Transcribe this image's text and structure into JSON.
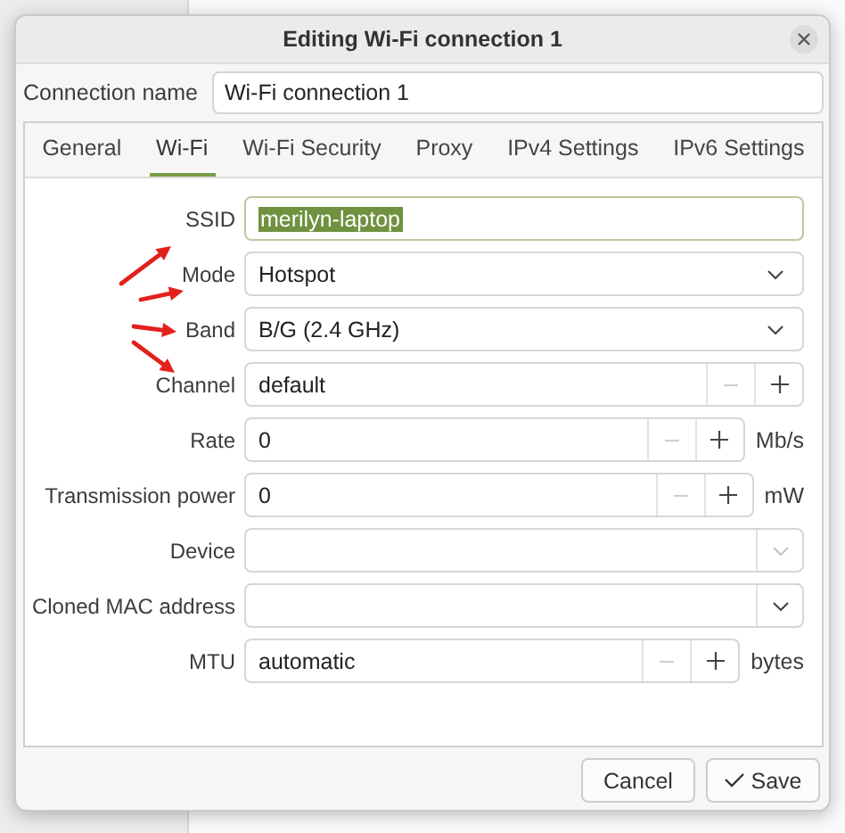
{
  "window": {
    "title": "Editing Wi-Fi connection 1"
  },
  "connection_name": {
    "label": "Connection name",
    "value": "Wi-Fi connection 1"
  },
  "tabs": [
    {
      "label": "General",
      "selected": false
    },
    {
      "label": "Wi-Fi",
      "selected": true
    },
    {
      "label": "Wi-Fi Security",
      "selected": false
    },
    {
      "label": "Proxy",
      "selected": false
    },
    {
      "label": "IPv4 Settings",
      "selected": false
    },
    {
      "label": "IPv6 Settings",
      "selected": false
    }
  ],
  "fields": [
    {
      "kind": "text",
      "label": "SSID",
      "value": "merilyn-laptop",
      "highlighted": true
    },
    {
      "kind": "dropdown",
      "label": "Mode",
      "value": "Hotspot",
      "arrowed": true
    },
    {
      "kind": "dropdown",
      "label": "Band",
      "value": "B/G (2.4 GHz)",
      "arrowed": true
    },
    {
      "kind": "spin",
      "label": "Channel",
      "value": "default",
      "decrement_disabled": true,
      "arrowed": true
    },
    {
      "kind": "spin",
      "label": "Rate",
      "value": "0",
      "unit": "Mb/s",
      "decrement_disabled": true
    },
    {
      "kind": "spin",
      "label": "Transmission power",
      "value": "0",
      "unit": "mW",
      "decrement_disabled": true
    },
    {
      "kind": "combo",
      "label": "Device",
      "button_disabled": true
    },
    {
      "kind": "combo",
      "label": "Cloned MAC address",
      "button_disabled": false
    },
    {
      "kind": "spin",
      "label": "MTU",
      "value": "automatic",
      "unit": "bytes",
      "decrement_disabled": true
    }
  ],
  "buttons": [
    {
      "kind": "cancel",
      "label": "Cancel"
    },
    {
      "kind": "save",
      "label": "Save"
    }
  ]
}
